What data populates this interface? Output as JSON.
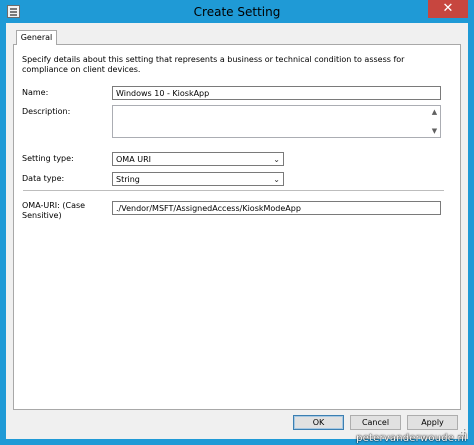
{
  "window": {
    "title": "Create Setting",
    "close_glyph": "✕",
    "icon": "settings-window-icon"
  },
  "tabs": [
    {
      "label": "General",
      "selected": true
    }
  ],
  "general": {
    "description": "Specify details about this setting that represents a business or technical condition to assess for compliance on client devices.",
    "name_label": "Name:",
    "name_value": "Windows 10 - KioskApp",
    "description_label": "Description:",
    "description_value": "",
    "setting_type_label": "Setting type:",
    "setting_type_value": "OMA URI",
    "data_type_label": "Data type:",
    "data_type_value": "String",
    "oma_uri_label": "OMA-URI: (Case Sensitive)",
    "oma_uri_value": "./Vendor/MSFT/AssignedAccess/KioskModeApp"
  },
  "buttons": {
    "ok": "OK",
    "cancel": "Cancel",
    "apply": "Apply"
  },
  "watermark": "petervanderwoude.nl",
  "colors": {
    "title_bar": "#1f9ad6",
    "close_button": "#c7463f",
    "dialog_background": "#f0f0f0"
  }
}
